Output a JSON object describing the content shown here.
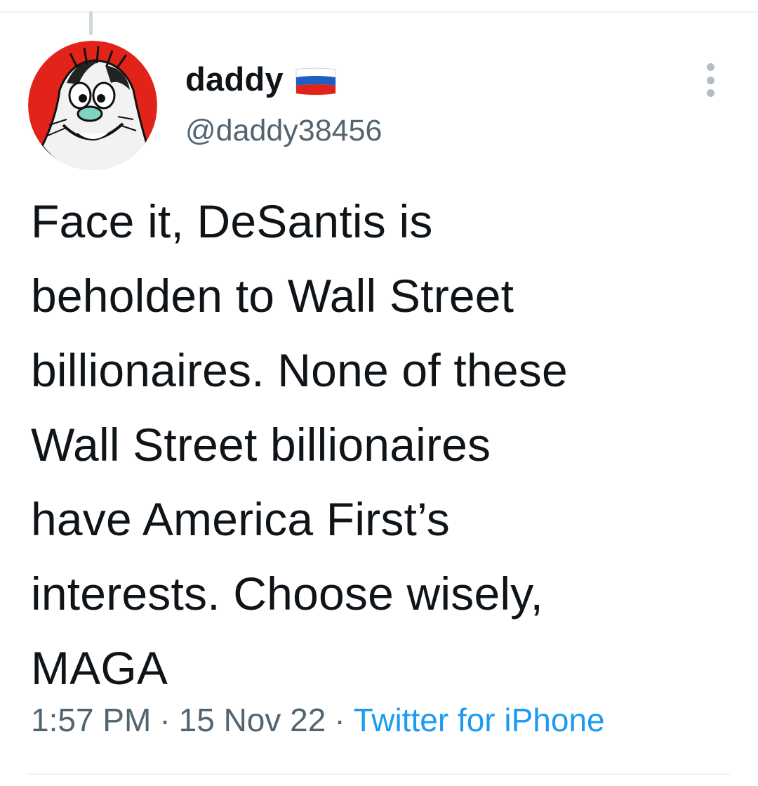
{
  "author": {
    "display_name": "daddy",
    "handle": "@daddy38456",
    "avatar": "cartoon-character-avatar",
    "flag": "russia-flag-icon"
  },
  "tweet": {
    "lines": [
      "Face it, DeSantis is",
      "beholden to Wall Street",
      "billionaires. None of these",
      "Wall Street billionaires",
      "have America First’s",
      "interests. Choose wisely,",
      "MAGA"
    ]
  },
  "meta": {
    "time": "1:57 PM",
    "separator": "·",
    "date": "15 Nov 22",
    "source": "Twitter for iPhone"
  },
  "colors": {
    "text": "#0f1419",
    "secondary": "#536471",
    "link": "#1d9bf0",
    "avatar_bg": "#e2231a"
  }
}
